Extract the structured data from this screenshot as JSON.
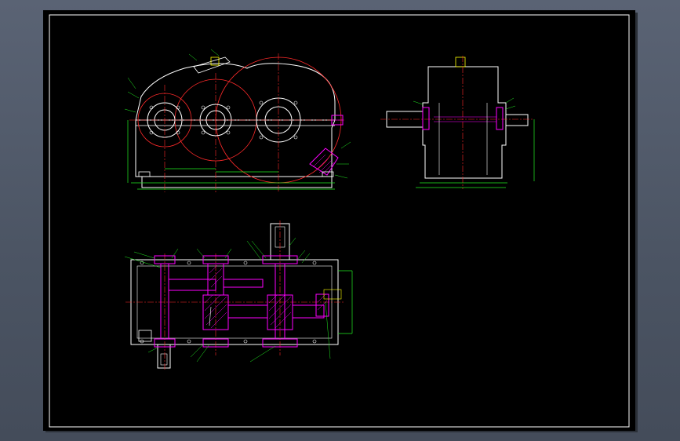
{
  "window": {
    "title": "",
    "background_color": "#4e5766"
  },
  "drawing": {
    "background_color": "#000000",
    "colors": {
      "outline": "#ffffff",
      "centerline": "#ff2a2a",
      "section_hatch": "#ff00ff",
      "dimension": "#22ee22",
      "hidden": "#ffff00"
    },
    "views": [
      {
        "id": "front-view",
        "description_icon": "gearbox-front-elevation"
      },
      {
        "id": "side-view",
        "description_icon": "gearbox-side-elevation"
      },
      {
        "id": "top-section-view",
        "description_icon": "gearbox-plan-section"
      }
    ]
  }
}
